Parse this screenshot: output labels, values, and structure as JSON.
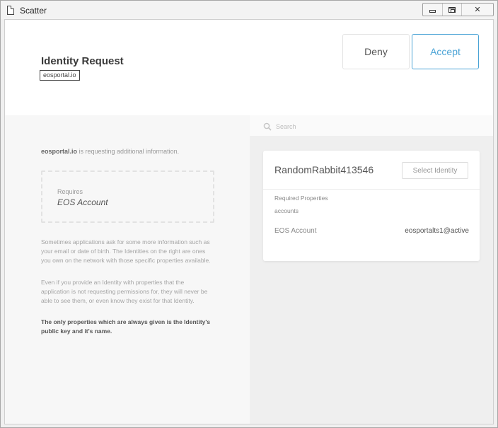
{
  "window": {
    "title": "Scatter",
    "controls": {
      "minimize": "minimize",
      "maximize": "maximize",
      "close": "✕"
    }
  },
  "header": {
    "title": "Identity Request",
    "domain": "eosportal.io",
    "deny_label": "Deny",
    "accept_label": "Accept"
  },
  "left": {
    "request_domain": "eosportal.io",
    "request_text": " is requesting additional information.",
    "requires_label": "Requires",
    "requires_value": "EOS Account",
    "paragraph1": "Sometimes applications ask for some more information such as your email or date of birth. The Identities on the right are ones you own on the network with those specific properties available.",
    "paragraph2": "Even if you provide an Identity with properties that the application is not requesting permissions for, they will never be able to see them, or even know they exist for that Identity.",
    "paragraph3": "The only properties which are always given is the Identity's public key and it's name."
  },
  "search": {
    "placeholder": "Search"
  },
  "identity": {
    "name": "RandomRabbit413546",
    "select_label": "Select Identity",
    "required_properties_label": "Required Properties",
    "required_properties_value": "accounts",
    "account_label": "EOS Account",
    "account_value": "eosportalts1@active"
  },
  "colors": {
    "accent": "#4aa3d6",
    "left_pane": "#f7f7f7",
    "right_pane": "#efefef"
  },
  "icons": [
    "file-icon",
    "minimize-icon",
    "maximize-icon",
    "close-icon",
    "search-icon"
  ]
}
